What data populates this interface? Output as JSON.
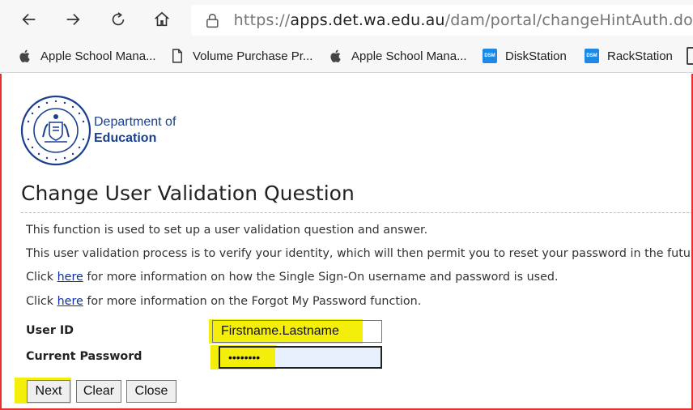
{
  "browser": {
    "address": {
      "prefix": "https://",
      "host": "apps.det.wa.edu.au",
      "path": "/dam/portal/changeHintAuth.do"
    },
    "bookmarks": [
      {
        "label": "Apple School Mana...",
        "icon": "apple-icon"
      },
      {
        "label": "Volume Purchase Pr...",
        "icon": "page-icon"
      },
      {
        "label": "Apple School Mana...",
        "icon": "apple-icon"
      },
      {
        "label": "DiskStation",
        "icon": "dsm-icon"
      },
      {
        "label": "RackStation",
        "icon": "dsm-icon"
      }
    ],
    "dsm_badge": "DSM"
  },
  "logo": {
    "line1": "Department of",
    "line2": "Education",
    "color": "#1b3f8f"
  },
  "page": {
    "title": "Change User Validation Question",
    "intro1": "This function is used to set up a user validation question and answer.",
    "intro2": "This user validation process is to verify your identity, which will then permit you to reset your password in the future.",
    "p3_before": "Click ",
    "p3_link": "here",
    "p3_after": " for more information on how the Single Sign-On username and password is used.",
    "p4_before": "Click ",
    "p4_link": "here",
    "p4_after": " for more information on the Forgot My Password function."
  },
  "form": {
    "user_id_label": "User ID",
    "user_id_value": "Firstname.Lastname",
    "password_label": "Current Password",
    "password_value": "••••••••"
  },
  "buttons": {
    "next": "Next",
    "clear": "Clear",
    "close": "Close"
  },
  "colors": {
    "highlight": "#f4ef0a",
    "frame": "#e8302c",
    "link": "#0a2fa8"
  }
}
